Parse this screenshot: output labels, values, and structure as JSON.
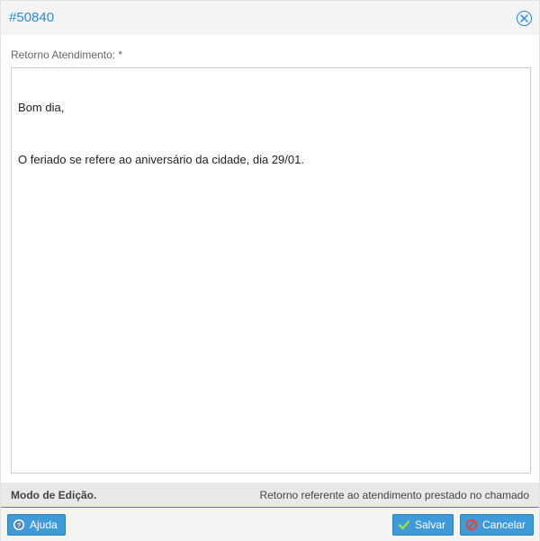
{
  "dialog": {
    "title": "#50840",
    "close_icon": "close-circle-icon"
  },
  "form": {
    "field_label": "Retorno Atendimento: *",
    "text_lines": [
      "Bom dia,",
      "O feriado se refere ao aniversário da cidade, dia 29/01."
    ]
  },
  "status": {
    "mode_label": "Modo de Edição.",
    "description": "Retorno referente ao atendimento prestado no chamado"
  },
  "buttons": {
    "help": {
      "label": "Ajuda",
      "icon": "help-circle-icon"
    },
    "save": {
      "label": "Salvar",
      "icon": "check-icon"
    },
    "cancel": {
      "label": "Cancelar",
      "icon": "cancel-circle-icon"
    }
  },
  "colors": {
    "accent": "#2a8bd0",
    "button": "#3f9ad8",
    "check": "#9fe23c",
    "cancel": "#e4473a"
  }
}
